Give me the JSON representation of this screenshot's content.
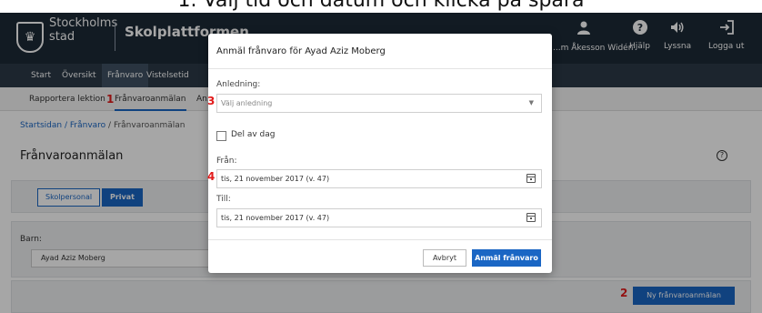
{
  "caption": "1. Välj tid och datum och klicka på spara",
  "header": {
    "logo_icon": "city-crest-icon",
    "brand_line1": "Stockholms",
    "brand_line2": "stad",
    "app_name": "Skolplattformen",
    "user_name": "...m Åkesson Widén",
    "help_label": "Hjälp",
    "listen_label": "Lyssna",
    "logout_label": "Logga ut"
  },
  "nav": {
    "items": [
      "Start",
      "Översikt",
      "Frånvaro",
      "Vistelsetid"
    ],
    "active": "Frånvaro"
  },
  "subnav": {
    "items": [
      "Rapportera lektion",
      "Frånvaroanmälan",
      "An..."
    ],
    "active": "Frånvaroanmälan"
  },
  "breadcrumb": {
    "home": "Startsidan",
    "section": "Frånvaro",
    "current": "Frånvaroanmälan",
    "sep": " / "
  },
  "page": {
    "title": "Frånvaroanmälan",
    "segments": [
      "Skolpersonal",
      "Privat"
    ],
    "active_segment": "Privat",
    "barn_label": "Barn:",
    "barn_value": "Ayad Aziz Moberg",
    "new_button": "Ny frånvaroanmälan"
  },
  "modal": {
    "title": "Anmäl frånvaro för Ayad Aziz Moberg",
    "reason_label": "Anledning:",
    "reason_placeholder": "Välj anledning",
    "part_of_day_label": "Del av dag",
    "part_of_day_checked": false,
    "from_label": "Från:",
    "from_value": "tis, 21 november 2017 (v. 47)",
    "to_label": "Till:",
    "to_value": "tis, 21 november 2017 (v. 47)",
    "cancel_label": "Avbryt",
    "submit_label": "Anmäl frånvaro"
  },
  "markers": [
    "1",
    "2",
    "3",
    "4"
  ],
  "colors": {
    "accent": "#1a66c4",
    "header": "#1d2a36",
    "marker": "#e21b1b"
  }
}
